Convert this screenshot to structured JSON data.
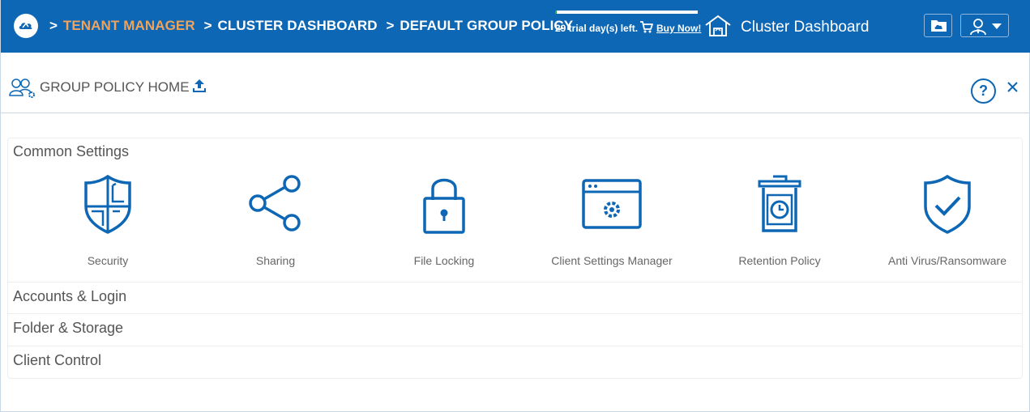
{
  "header": {
    "breadcrumbs": [
      {
        "label": "TENANT MANAGER",
        "active": true
      },
      {
        "label": "CLUSTER DASHBOARD",
        "active": false
      },
      {
        "label": "DEFAULT GROUP POLICY",
        "active": false
      }
    ],
    "breadcrumb_separator": ">",
    "trial_text": "29 trial day(s) left.",
    "trial_progress_fraction": 0.01,
    "buy_now": "Buy Now!",
    "dashboard_title": "Cluster Dashboard"
  },
  "page": {
    "title": "GROUP POLICY HOME",
    "help_label": "?"
  },
  "sections": {
    "common": {
      "title": "Common Settings",
      "items": [
        {
          "label": "Security",
          "icon": "shield-grid-icon"
        },
        {
          "label": "Sharing",
          "icon": "share-icon"
        },
        {
          "label": "File Locking",
          "icon": "padlock-icon"
        },
        {
          "label": "Client Settings Manager",
          "icon": "window-gear-icon"
        },
        {
          "label": "Retention Policy",
          "icon": "trash-clock-icon"
        },
        {
          "label": "Anti Virus/Ransomware",
          "icon": "shield-check-icon"
        }
      ]
    },
    "accounts": {
      "title": "Accounts & Login"
    },
    "folder": {
      "title": "Folder & Storage"
    },
    "client": {
      "title": "Client Control"
    }
  },
  "colors": {
    "brand_blue": "#0d67b5",
    "breadcrumb_active": "#f0a35a",
    "trial_progress": "#27a845"
  }
}
